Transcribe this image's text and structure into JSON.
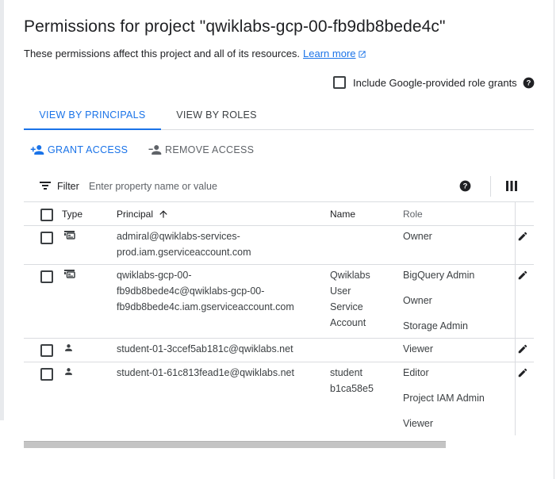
{
  "header": {
    "title": "Permissions for project \"qwiklabs-gcp-00-fb9db8bede4c\"",
    "subtitle": "These permissions affect this project and all of its resources.",
    "learn_more": "Learn more"
  },
  "include_grants": {
    "label": "Include Google-provided role grants",
    "checked": false
  },
  "tabs": [
    {
      "label": "VIEW BY PRINCIPALS",
      "active": true
    },
    {
      "label": "VIEW BY ROLES",
      "active": false
    }
  ],
  "actions": {
    "grant": "GRANT ACCESS",
    "remove": "REMOVE ACCESS"
  },
  "filter": {
    "label": "Filter",
    "placeholder": "Enter property name or value"
  },
  "table": {
    "columns": {
      "type": "Type",
      "principal": "Principal",
      "name": "Name",
      "role": "Role"
    },
    "sort": {
      "column": "principal",
      "direction": "ascending"
    },
    "rows": [
      {
        "type_icon": "service-account-icon",
        "principal_lines": [
          "admiral@qwiklabs-services-",
          "prod.iam.gserviceaccount.com"
        ],
        "name_lines": [],
        "roles": [
          "Owner"
        ]
      },
      {
        "type_icon": "service-account-icon",
        "principal_lines": [
          "qwiklabs-gcp-00-",
          "fb9db8bede4c@qwiklabs-gcp-00-",
          "fb9db8bede4c.iam.gserviceaccount.com"
        ],
        "name_lines": [
          "Qwiklabs",
          "User",
          "Service",
          "Account"
        ],
        "roles": [
          "BigQuery Admin",
          "Owner",
          "Storage Admin"
        ]
      },
      {
        "type_icon": "person-icon",
        "principal_lines": [
          "student-01-3ccef5ab181c@qwiklabs.net"
        ],
        "name_lines": [],
        "roles": [
          "Viewer"
        ]
      },
      {
        "type_icon": "person-icon",
        "principal_lines": [
          "student-01-61c813fead1e@qwiklabs.net"
        ],
        "name_lines": [
          "student",
          "b1ca58e5"
        ],
        "roles": [
          "Editor",
          "Project IAM Admin",
          "Viewer"
        ]
      }
    ]
  }
}
